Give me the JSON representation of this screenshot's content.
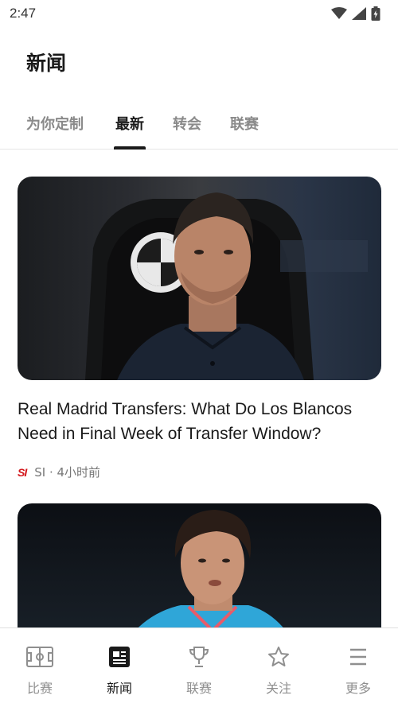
{
  "status": {
    "time": "2:47"
  },
  "header": {
    "title": "新闻"
  },
  "tabs": [
    {
      "label": "为你定制",
      "active": false
    },
    {
      "label": "最新",
      "active": true
    },
    {
      "label": "转会",
      "active": false
    },
    {
      "label": "联赛",
      "active": false
    }
  ],
  "articles": [
    {
      "title": "Real Madrid Transfers: What Do Los Blancos Need in Final Week of Transfer Window?",
      "source_logo": "SI",
      "source": "SI · 4小时前"
    }
  ],
  "bottom_nav": [
    {
      "label": "比赛",
      "icon": "pitch-icon",
      "active": false
    },
    {
      "label": "新闻",
      "icon": "news-icon",
      "active": true
    },
    {
      "label": "联赛",
      "icon": "trophy-icon",
      "active": false
    },
    {
      "label": "关注",
      "icon": "star-icon",
      "active": false
    },
    {
      "label": "更多",
      "icon": "menu-icon",
      "active": false
    }
  ]
}
